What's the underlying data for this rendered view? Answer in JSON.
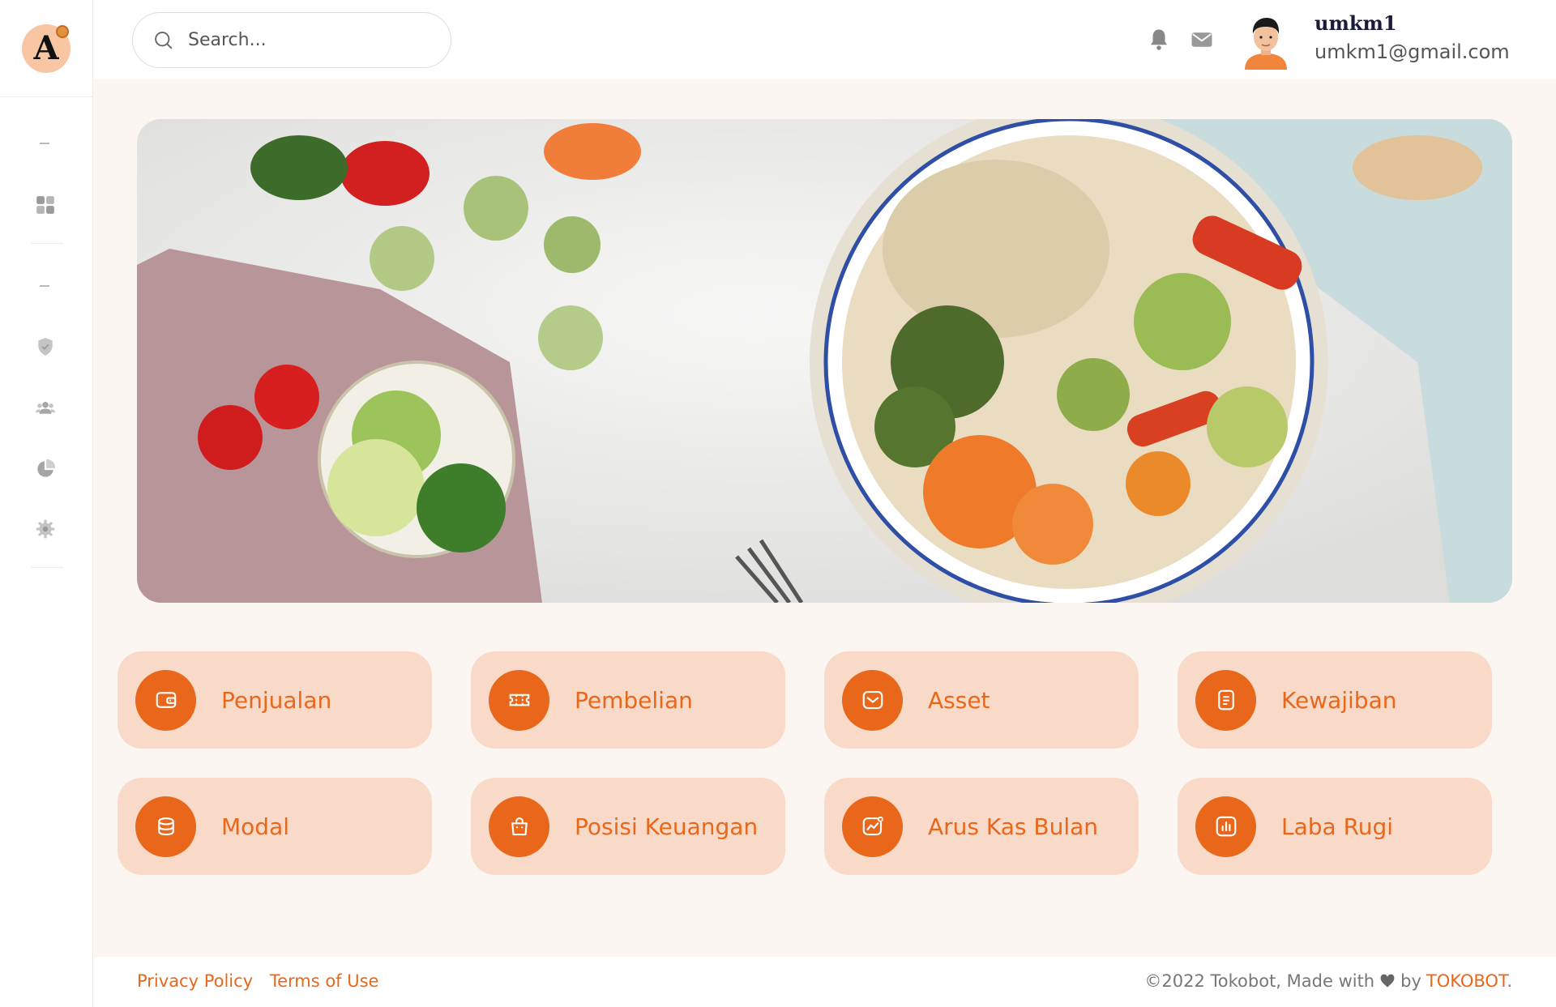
{
  "app": {
    "logo_letter": "A"
  },
  "sidebar": {
    "items": [
      {
        "icon": "dashboard-icon"
      },
      {
        "icon": "shield-icon"
      },
      {
        "icon": "users-icon"
      },
      {
        "icon": "pie-chart-icon"
      },
      {
        "icon": "settings-icon"
      }
    ]
  },
  "header": {
    "search_placeholder": "Search...",
    "user_name": "umkm1",
    "user_email": "umkm1@gmail.com",
    "icons": [
      "bell-icon",
      "mail-icon"
    ]
  },
  "cards": [
    {
      "label": "Penjualan",
      "icon": "wallet-icon"
    },
    {
      "label": "Pembelian",
      "icon": "ticket-icon"
    },
    {
      "label": "Asset",
      "icon": "inbox-icon"
    },
    {
      "label": "Kewajiban",
      "icon": "document-icon"
    },
    {
      "label": "Modal",
      "icon": "coins-icon"
    },
    {
      "label": "Posisi Keuangan",
      "icon": "bag-icon"
    },
    {
      "label": "Arus Kas Bulan",
      "icon": "trend-icon"
    },
    {
      "label": "Laba Rugi",
      "icon": "bar-chart-icon"
    }
  ],
  "footer": {
    "privacy": "Privacy Policy",
    "terms": "Terms of Use",
    "copy_prefix": "©2022 Tokobot, Made with",
    "copy_by": "by",
    "brand": "TOKOBOT",
    "period": "."
  },
  "colors": {
    "accent": "#e9671a",
    "card_bg": "#f9dac8",
    "page_bg": "#fbf6f1"
  }
}
